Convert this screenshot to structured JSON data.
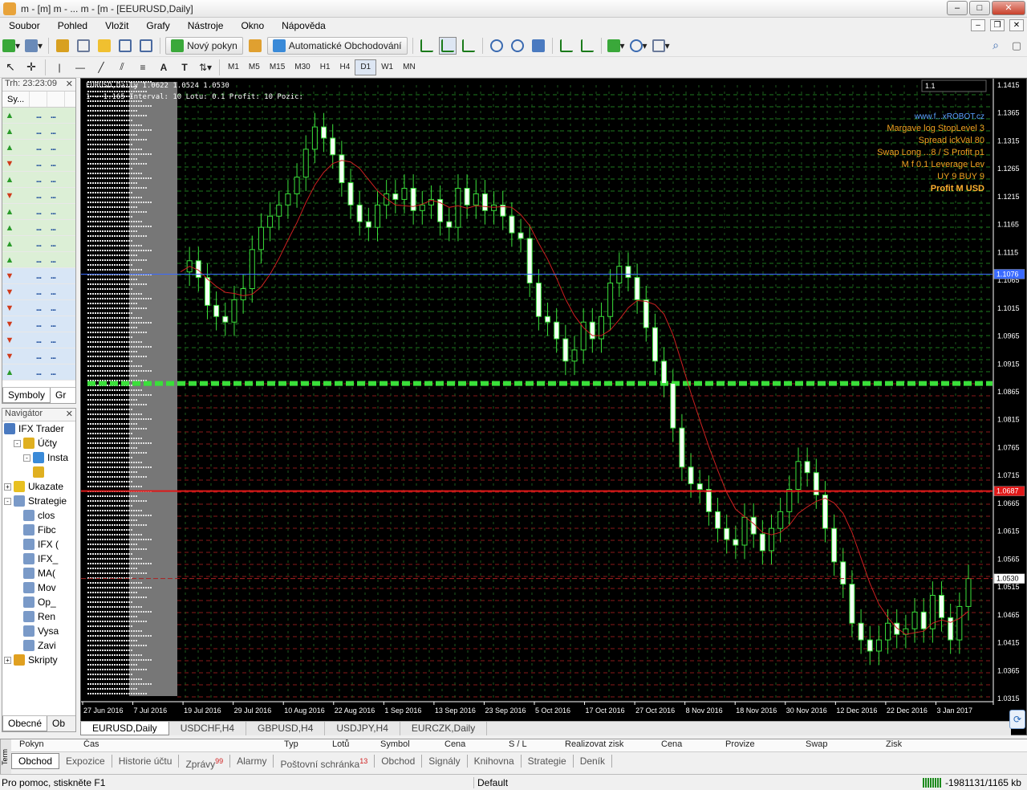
{
  "window": {
    "title": "m - [m] m - ... m - [m - [EEURUSD,Daily]"
  },
  "menu": [
    "Soubor",
    "Pohled",
    "Vložit",
    "Grafy",
    "Nástroje",
    "Okno",
    "Nápověda"
  ],
  "toolbar1": {
    "new_order": "Nový pokyn",
    "auto_trading": "Automatické Obchodování"
  },
  "timeframes": [
    "M1",
    "M5",
    "M15",
    "M30",
    "H1",
    "H4",
    "D1",
    "W1",
    "MN"
  ],
  "active_timeframe": "D1",
  "market_watch": {
    "header": "Trh: 23:23:09",
    "col_symbol": "Sy...",
    "rows": [
      {
        "dir": "up",
        "bg": "g"
      },
      {
        "dir": "up",
        "bg": "g"
      },
      {
        "dir": "up",
        "bg": "g"
      },
      {
        "dir": "down",
        "bg": "g"
      },
      {
        "dir": "up",
        "bg": "g"
      },
      {
        "dir": "down",
        "bg": "g"
      },
      {
        "dir": "up",
        "bg": "g"
      },
      {
        "dir": "up",
        "bg": "g"
      },
      {
        "dir": "up",
        "bg": "g"
      },
      {
        "dir": "up",
        "bg": "g"
      },
      {
        "dir": "down",
        "bg": "b"
      },
      {
        "dir": "down",
        "bg": "b"
      },
      {
        "dir": "down",
        "bg": "b"
      },
      {
        "dir": "down",
        "bg": "b"
      },
      {
        "dir": "down",
        "bg": "b"
      },
      {
        "dir": "down",
        "bg": "b"
      },
      {
        "dir": "up",
        "bg": "b"
      }
    ],
    "tabs": [
      "Symboly",
      "Gr"
    ]
  },
  "navigator": {
    "header": "Navigátor",
    "items": [
      {
        "label": "IFX Trader",
        "level": 0,
        "exp": "",
        "icon": "app-icon",
        "color": "#4a7ac0"
      },
      {
        "label": "Účty",
        "level": 1,
        "exp": "-",
        "icon": "accounts-icon",
        "color": "#e0b020"
      },
      {
        "label": "Insta",
        "level": 2,
        "exp": "-",
        "icon": "account-icon",
        "color": "#3a8ad8"
      },
      {
        "label": "",
        "level": 3,
        "exp": "",
        "icon": "user-icon",
        "color": "#e0b020"
      },
      {
        "label": "Ukazate",
        "level": 0,
        "exp": "+",
        "icon": "indicators-icon",
        "color": "#e8c020"
      },
      {
        "label": "Strategie",
        "level": 0,
        "exp": "-",
        "icon": "experts-icon",
        "color": "#7a9ac8"
      },
      {
        "label": "clos",
        "level": 2,
        "exp": "",
        "icon": "expert-icon",
        "color": "#7a9ac8"
      },
      {
        "label": "Fibc",
        "level": 2,
        "exp": "",
        "icon": "expert-icon",
        "color": "#7a9ac8"
      },
      {
        "label": "IFX (",
        "level": 2,
        "exp": "",
        "icon": "expert-icon",
        "color": "#7a9ac8"
      },
      {
        "label": "IFX_",
        "level": 2,
        "exp": "",
        "icon": "expert-icon",
        "color": "#7a9ac8"
      },
      {
        "label": "MA(",
        "level": 2,
        "exp": "",
        "icon": "expert-icon",
        "color": "#7a9ac8"
      },
      {
        "label": "Mov",
        "level": 2,
        "exp": "",
        "icon": "expert-icon",
        "color": "#7a9ac8"
      },
      {
        "label": "Op_",
        "level": 2,
        "exp": "",
        "icon": "expert-icon",
        "color": "#7a9ac8"
      },
      {
        "label": "Ren",
        "level": 2,
        "exp": "",
        "icon": "expert-icon",
        "color": "#7a9ac8"
      },
      {
        "label": "Vysa",
        "level": 2,
        "exp": "",
        "icon": "expert-icon",
        "color": "#7a9ac8"
      },
      {
        "label": "Zavi",
        "level": 2,
        "exp": "",
        "icon": "expert-icon",
        "color": "#7a9ac8"
      },
      {
        "label": "Skripty",
        "level": 0,
        "exp": "+",
        "icon": "scripts-icon",
        "color": "#e0a020"
      }
    ],
    "tabs": [
      "Obecné",
      "Ob"
    ]
  },
  "chart": {
    "info_line1": "EURUSD,Daily 1.0622 1.0524 1.0530",
    "info_line2": "1 - 1.165  Interval: 10  Lotu: 0.1  Profit: 10  Pozic:",
    "price_labels": [
      "1.1415",
      "1.1365",
      "1.1315",
      "1.1265",
      "1.1215",
      "1.1165",
      "1.1115",
      "1.1065",
      "1.1015",
      "1.0965",
      "1.0915",
      "1.0865",
      "1.0815",
      "1.0765",
      "1.0715",
      "1.0665",
      "1.0615",
      "1.0565",
      "1.0515",
      "1.0465",
      "1.0415",
      "1.0365",
      "1.0315"
    ],
    "price_max": 1.1415,
    "price_min": 1.0315,
    "date_labels": [
      "27 Jun 2016",
      "7 Jul 2016",
      "19 Jul 2016",
      "29 Jul 2016",
      "10 Aug 2016",
      "22 Aug 2016",
      "1 Sep 2016",
      "13 Sep 2016",
      "23 Sep 2016",
      "5 Oct 2016",
      "17 Oct 2016",
      "27 Oct 2016",
      "8 Nov 2016",
      "18 Nov 2016",
      "30 Nov 2016",
      "12 Dec 2016",
      "22 Dec 2016",
      "3 Jan 2017"
    ],
    "blue_line_price": 1.1076,
    "red_line_price": 1.0687,
    "bid_price": 1.053,
    "blue_line_label": "1.1076",
    "red_line_label": "1.0687",
    "bid_label": "1.0530",
    "ea_panel": {
      "url": "www.f...xROBOT.cz",
      "line1": "Margave  log  StopLevel 3",
      "line2": "Spread  ickVal  80",
      "line3": "Swap Long  ...8 / S  Profit  p1",
      "line4": "M  f 0.1  Leverage  Lev",
      "line5": "UY 9  BUY 9",
      "line6": "Profit  M  USD"
    },
    "corner_label": "1.1"
  },
  "chart_tabs": [
    "EURUSD,Daily",
    "USDCHF,H4",
    "GBPUSD,H4",
    "USDJPY,H4",
    "EURCZK,Daily"
  ],
  "terminal": {
    "side_label": "Term",
    "columns": [
      "Pokyn",
      "Čas",
      "Typ",
      "Lotů",
      "Symbol",
      "Cena",
      "S / L",
      "Realizovat zisk",
      "Cena",
      "Provize",
      "Swap",
      "Zisk"
    ],
    "tabs": [
      {
        "label": "Obchod",
        "badge": ""
      },
      {
        "label": "Expozice",
        "badge": ""
      },
      {
        "label": "Historie účtu",
        "badge": ""
      },
      {
        "label": "Zprávy",
        "badge": "99"
      },
      {
        "label": "Alarmy",
        "badge": ""
      },
      {
        "label": "Poštovní schránka",
        "badge": "13"
      },
      {
        "label": "Obchod",
        "badge": ""
      },
      {
        "label": "Signály",
        "badge": ""
      },
      {
        "label": "Knihovna",
        "badge": ""
      },
      {
        "label": "Strategie",
        "badge": ""
      },
      {
        "label": "Deník",
        "badge": ""
      }
    ]
  },
  "status": {
    "help": "Pro pomoc, stiskněte F1",
    "profile": "Default",
    "connection": "-1981131/1165 kb"
  },
  "chart_data": {
    "type": "candlestick",
    "symbol": "EURUSD",
    "timeframe": "Daily",
    "ylim": [
      1.0315,
      1.1415
    ],
    "x": [
      "27 Jun 2016",
      "7 Jul 2016",
      "19 Jul 2016",
      "29 Jul 2016",
      "10 Aug 2016",
      "22 Aug 2016",
      "1 Sep 2016",
      "13 Sep 2016",
      "23 Sep 2016",
      "5 Oct 2016",
      "17 Oct 2016",
      "27 Oct 2016",
      "8 Nov 2016",
      "18 Nov 2016",
      "30 Nov 2016",
      "12 Dec 2016",
      "22 Dec 2016",
      "3 Jan 2017"
    ],
    "close_path": [
      1.108,
      1.11,
      1.107,
      1.102,
      1.1,
      1.099,
      1.103,
      1.105,
      1.112,
      1.116,
      1.118,
      1.12,
      1.122,
      1.125,
      1.13,
      1.134,
      1.132,
      1.129,
      1.124,
      1.12,
      1.117,
      1.116,
      1.12,
      1.122,
      1.121,
      1.123,
      1.119,
      1.12,
      1.121,
      1.117,
      1.116,
      1.123,
      1.12,
      1.122,
      1.119,
      1.12,
      1.118,
      1.115,
      1.114,
      1.106,
      1.1,
      1.099,
      1.096,
      1.092,
      1.094,
      1.099,
      1.096,
      1.1,
      1.106,
      1.109,
      1.107,
      1.103,
      1.098,
      1.092,
      1.088,
      1.08,
      1.073,
      1.07,
      1.069,
      1.065,
      1.062,
      1.06,
      1.059,
      1.064,
      1.061,
      1.058,
      1.062,
      1.065,
      1.069,
      1.074,
      1.072,
      1.068,
      1.062,
      1.056,
      1.052,
      1.045,
      1.042,
      1.04,
      1.042,
      1.045,
      1.043,
      1.044,
      1.047,
      1.044,
      1.05,
      1.046,
      1.042,
      1.048,
      1.053
    ],
    "moving_average_color": "#cc2020"
  }
}
